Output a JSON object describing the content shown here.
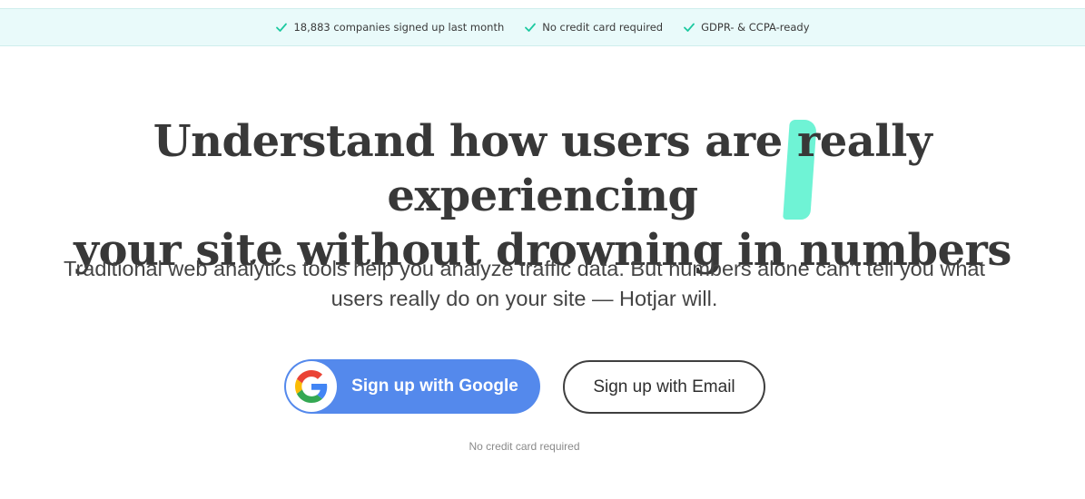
{
  "topbar": {
    "accent": "#1cc9a0",
    "items": [
      {
        "icon": "check-icon",
        "label": "18,883 companies signed up last month"
      },
      {
        "icon": "check-icon",
        "label": "No credit card required"
      },
      {
        "icon": "check-icon",
        "label": "GDPR- & CCPA-ready"
      }
    ]
  },
  "hero": {
    "headline_before": "Understand how users are ",
    "headline_highlight": "really experiencing",
    "headline_after": "your site without drowning in numbers",
    "highlight_color": "#5ff2d0",
    "subtext_line1": "Traditional web analytics tools help you analyze traffic data. But numbers alone can’t tell you what",
    "subtext_line2": "users really do on your site — Hotjar will."
  },
  "cta": {
    "google_label": "Sign up with Google",
    "google_icon": "google-logo-icon",
    "google_color": "#5489ec",
    "email_label": "Sign up with Email",
    "note": "No credit card required"
  }
}
